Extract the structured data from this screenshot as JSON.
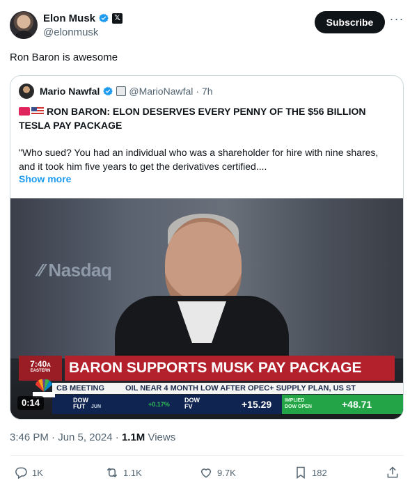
{
  "author": {
    "display_name": "Elon Musk",
    "handle": "@elonmusk",
    "subscribe_label": "Subscribe",
    "more_label": "···"
  },
  "tweet": {
    "text": "Ron Baron is awesome",
    "timestamp": "3:46 PM · Jun 5, 2024",
    "separator": " · ",
    "views_count": "1.1M",
    "views_label": " Views"
  },
  "quote": {
    "display_name": "Mario Nawfal",
    "handle": "@MarioNawfal",
    "time": "· 7h",
    "title": "RON BARON: ELON DESERVES EVERY PENNY OF THE $56 BILLION TESLA PAY PACKAGE",
    "body": "\"Who sued? You had an individual who was a shareholder for hire with nine shares, and it took him five years to get the derivatives certified....",
    "show_more": "Show more"
  },
  "video": {
    "duration": "0:14",
    "bg_logo": "Nasdaq",
    "clock": "7:40",
    "clock_ampm": "A",
    "clock_zone": "EASTERN",
    "headline": "BARON SUPPORTS MUSK PAY PACKAGE",
    "ticker_left": "CB MEETING",
    "ticker_right": "OIL NEAR 4 MONTH LOW AFTER OPEC+ SUPPLY PLAN, US ST",
    "dow_fut_label": "DOW",
    "dow_fut_sub": "FUT",
    "dow_fut_month": "JUN",
    "dow_fut_pct": "+0.17%",
    "dow_fv_label": "DOW",
    "dow_fv_sub": "FV",
    "dow_fv_value": "+15.29",
    "implied_label_1": "IMPLIED",
    "implied_label_2": "DOW OPEN",
    "implied_value": "+48.71",
    "network_logo": "CNBC"
  },
  "actions": {
    "replies": "1K",
    "retweets": "1.1K",
    "likes": "9.7K",
    "bookmarks": "182"
  },
  "colors": {
    "accent": "#1d9bf0",
    "text": "#0f1419",
    "muted": "#536471",
    "border": "#cfd9de"
  }
}
